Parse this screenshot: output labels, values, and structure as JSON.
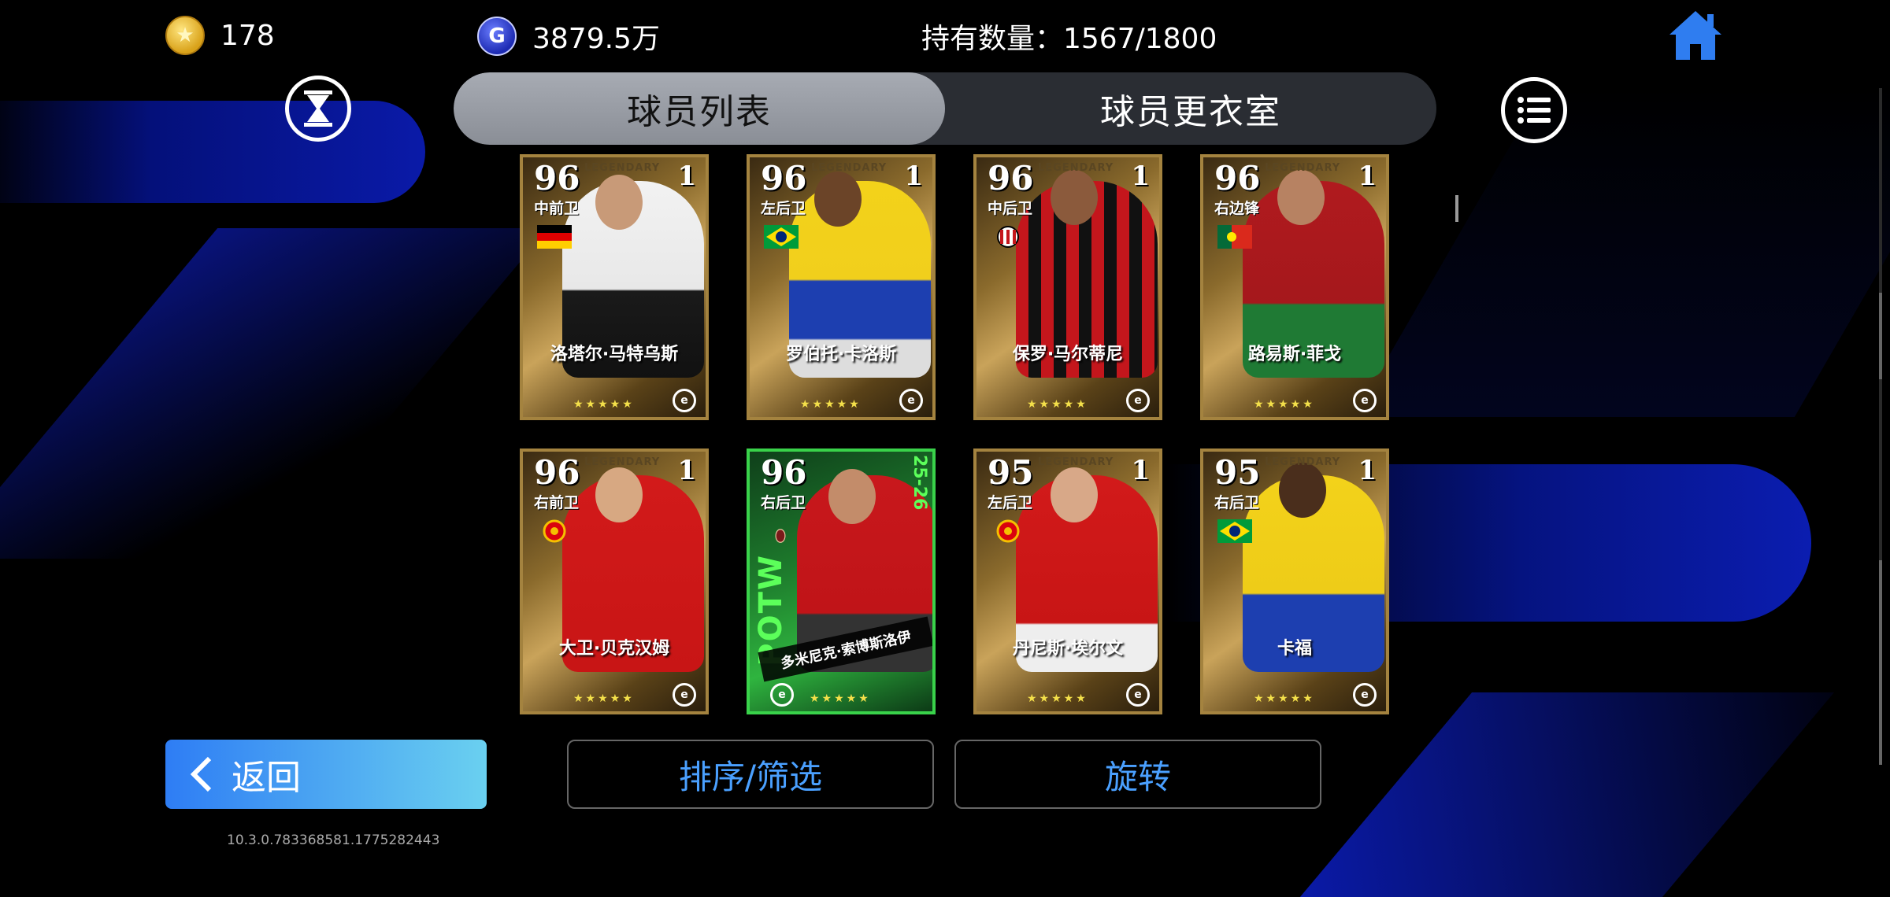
{
  "currency": {
    "coins_icon": "gold-coin-star-icon",
    "coins": "178",
    "gp_icon": "gp-coin-icon",
    "gp_symbol": "G",
    "gp": "3879.5万"
  },
  "ownership": {
    "text": "持有数量：1567/1800"
  },
  "tabs": [
    {
      "label": "球员列表",
      "active": true
    },
    {
      "label": "球员更衣室",
      "active": false
    }
  ],
  "cards": [
    {
      "rating": "96",
      "level": "1",
      "tier": "LEGENDARY",
      "position": "中前卫",
      "badge": "germany-flag",
      "name": "洛塔尔·马特乌斯",
      "stars": "★★★★★"
    },
    {
      "rating": "96",
      "level": "1",
      "tier": "LEGENDARY",
      "position": "左后卫",
      "badge": "brazil-flag",
      "name": "罗伯托·卡洛斯",
      "stars": "★★★★★"
    },
    {
      "rating": "96",
      "level": "1",
      "tier": "LEGENDARY",
      "position": "中后卫",
      "badge": "ac-milan-crest",
      "name": "保罗·马尔蒂尼",
      "stars": "★★★★★"
    },
    {
      "rating": "96",
      "level": "1",
      "tier": "LEGENDARY",
      "position": "右边锋",
      "badge": "portugal-flag",
      "name": "路易斯·菲戈",
      "stars": "★★★★★"
    },
    {
      "rating": "96",
      "level": "1",
      "tier": "LEGENDARY",
      "position": "右前卫",
      "badge": "man-utd-crest",
      "name": "大卫·贝克汉姆",
      "stars": "★★★★★"
    },
    {
      "rating": "96",
      "level": "",
      "tier": "",
      "position": "右后卫",
      "badge": "club-crest",
      "name": "多米尼克·索博斯洛伊",
      "stars": "★★★★★",
      "potw": "POTW",
      "season": "25-26"
    },
    {
      "rating": "95",
      "level": "1",
      "tier": "LEGENDARY",
      "position": "左后卫",
      "badge": "man-utd-crest",
      "name": "丹尼斯·埃尔文",
      "stars": "★★★★★"
    },
    {
      "rating": "95",
      "level": "1",
      "tier": "LEGENDARY",
      "position": "右后卫",
      "badge": "brazil-flag",
      "name": "卡福",
      "stars": "★★★★★"
    }
  ],
  "buttons": {
    "back": "返回",
    "sort_filter": "排序/筛选",
    "rotate": "旋转"
  },
  "version": "10.3.0.783368581.1775282443",
  "colors": {
    "accent_blue": "#4aa0ff",
    "back_gradient_start": "#2e7df4",
    "back_gradient_end": "#6ad0f0",
    "legendary_border": "#a4833f",
    "potw_green": "#39d24a",
    "home_icon": "#2f7df0"
  }
}
